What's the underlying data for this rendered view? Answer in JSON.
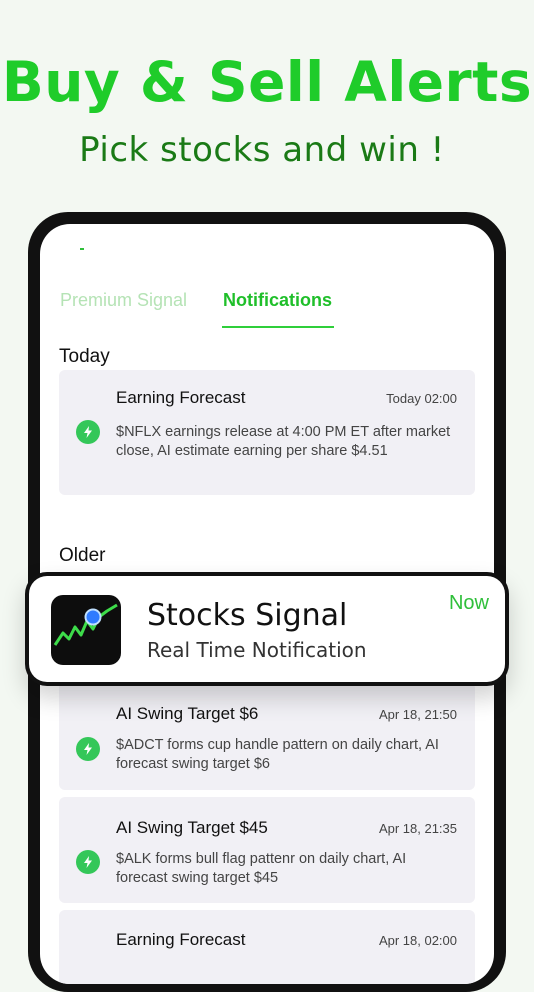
{
  "promo": {
    "headline": "Buy & Sell Alerts",
    "subline": "Pick stocks and win !"
  },
  "tabs": [
    {
      "label": "Premium Signal",
      "active": false
    },
    {
      "label": "Notifications",
      "active": true
    }
  ],
  "sections": {
    "today": "Today",
    "older": "Older"
  },
  "today_items": [
    {
      "title": "Earning Forecast",
      "time": "Today 02:00",
      "body": "$NFLX earnings release at 4:00 PM ET after market close, AI estimate earning per share $4.51",
      "icon": "lightning-bolt-icon"
    }
  ],
  "older_items": [
    {
      "title": "AI Swing Target $6",
      "time": "Apr 18, 21:50",
      "body": "$ADCT forms cup handle pattern on daily chart, AI forecast swing target $6",
      "icon": "lightning-bolt-icon"
    },
    {
      "title": "AI Swing Target $45",
      "time": "Apr 18, 21:35",
      "body": "$ALK forms bull flag pattenr on daily chart, AI forecast swing target $45",
      "icon": "lightning-bolt-icon"
    },
    {
      "title": "Earning Forecast",
      "time": "Apr 18, 02:00",
      "body": "",
      "icon": "lightning-bolt-icon"
    }
  ],
  "banner": {
    "app_name": "Stocks Signal",
    "subtitle": "Real Time Notification",
    "time": "Now",
    "icon": "stock-chart-app-icon"
  },
  "colors": {
    "brand_green": "#1fcc2a",
    "dark_green": "#1a7a16",
    "bolt_green": "#34c759",
    "card_bg": "#f1f0f5"
  }
}
